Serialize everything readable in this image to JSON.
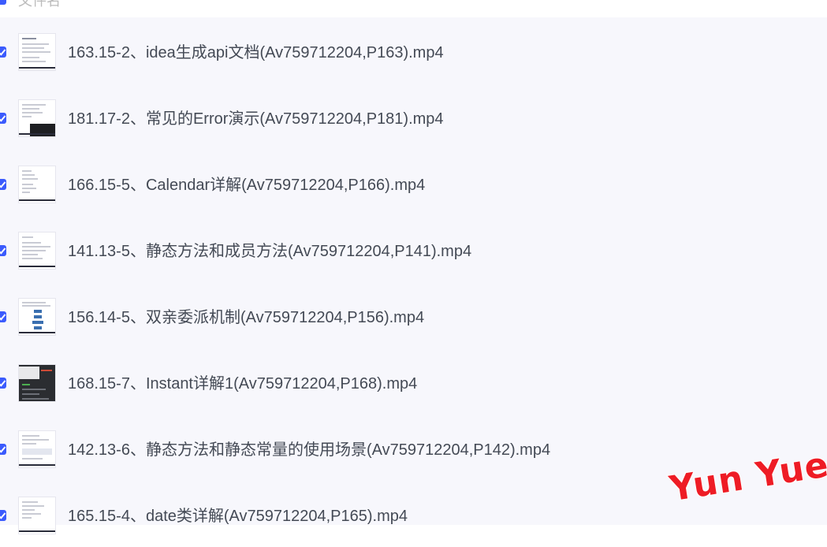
{
  "header": {
    "column_label": "文件名"
  },
  "files": [
    {
      "name": "163.15-2、idea生成api文档(Av759712204,P163).mp4",
      "checked": true,
      "thumb": "light-doc"
    },
    {
      "name": "181.17-2、常见的Error演示(Av759712204,P181).mp4",
      "checked": true,
      "thumb": "ide-dark-bottom"
    },
    {
      "name": "166.15-5、Calendar详解(Av759712204,P166).mp4",
      "checked": true,
      "thumb": "light-doc"
    },
    {
      "name": "141.13-5、静态方法和成员方法(Av759712204,P141).mp4",
      "checked": true,
      "thumb": "light-doc"
    },
    {
      "name": "156.14-5、双亲委派机制(Av759712204,P156).mp4",
      "checked": true,
      "thumb": "diagram-blue"
    },
    {
      "name": "168.15-7、Instant详解1(Av759712204,P168).mp4",
      "checked": true,
      "thumb": "ide-dark"
    },
    {
      "name": "142.13-6、静态方法和静态常量的使用场景(Av759712204,P142).mp4",
      "checked": true,
      "thumb": "light-doc"
    },
    {
      "name": "165.15-4、date类详解(Av759712204,P165).mp4",
      "checked": true,
      "thumb": "light-doc"
    }
  ],
  "watermark": "Yun Yue"
}
